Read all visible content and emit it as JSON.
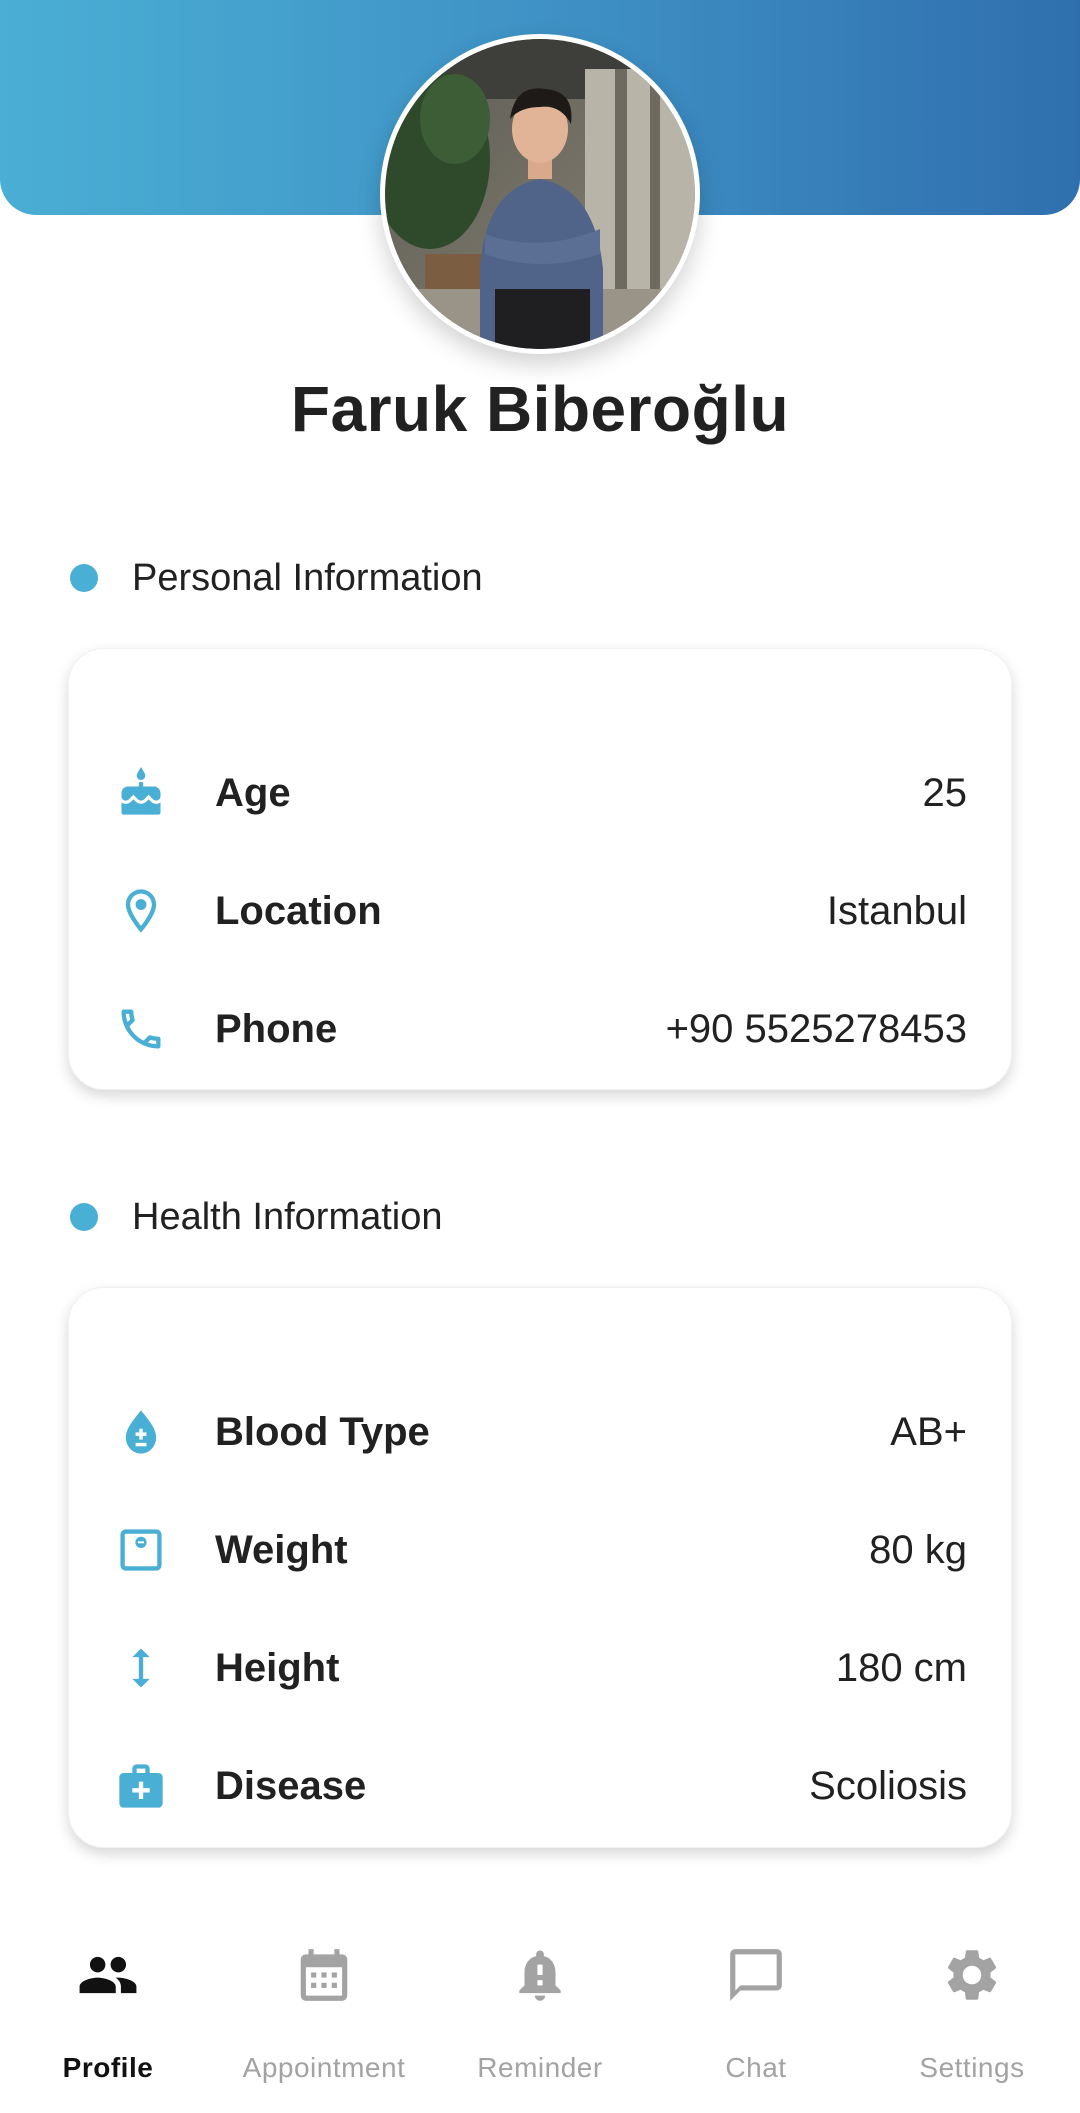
{
  "profile": {
    "name": "Faruk Biberoğlu",
    "avatar": "profile-photo"
  },
  "colors": {
    "accent": "#4aafd4",
    "header_gradient_start": "#4aafd4",
    "header_gradient_end": "#2f6fae",
    "nav_active": "#111111",
    "nav_inactive": "#a3a3a3"
  },
  "personal": {
    "title": "Personal Information",
    "rows": [
      {
        "icon": "cake-icon",
        "label": "Age",
        "value": "25"
      },
      {
        "icon": "location-pin-icon",
        "label": "Location",
        "value": "Istanbul"
      },
      {
        "icon": "phone-icon",
        "label": "Phone",
        "value": "+90 5525278453"
      }
    ]
  },
  "health": {
    "title": "Health Information",
    "rows": [
      {
        "icon": "blood-drop-icon",
        "label": "Blood Type",
        "value": "AB+"
      },
      {
        "icon": "scale-icon",
        "label": "Weight",
        "value": "80 kg"
      },
      {
        "icon": "height-arrows-icon",
        "label": "Height",
        "value": "180 cm"
      },
      {
        "icon": "medical-kit-icon",
        "label": "Disease",
        "value": "Scoliosis"
      }
    ]
  },
  "nav": {
    "items": [
      {
        "icon": "people-icon",
        "label": "Profile",
        "active": true
      },
      {
        "icon": "calendar-icon",
        "label": "Appointment",
        "active": false
      },
      {
        "icon": "bell-alert-icon",
        "label": "Reminder",
        "active": false
      },
      {
        "icon": "chat-bubble-icon",
        "label": "Chat",
        "active": false
      },
      {
        "icon": "gear-icon",
        "label": "Settings",
        "active": false
      }
    ]
  }
}
